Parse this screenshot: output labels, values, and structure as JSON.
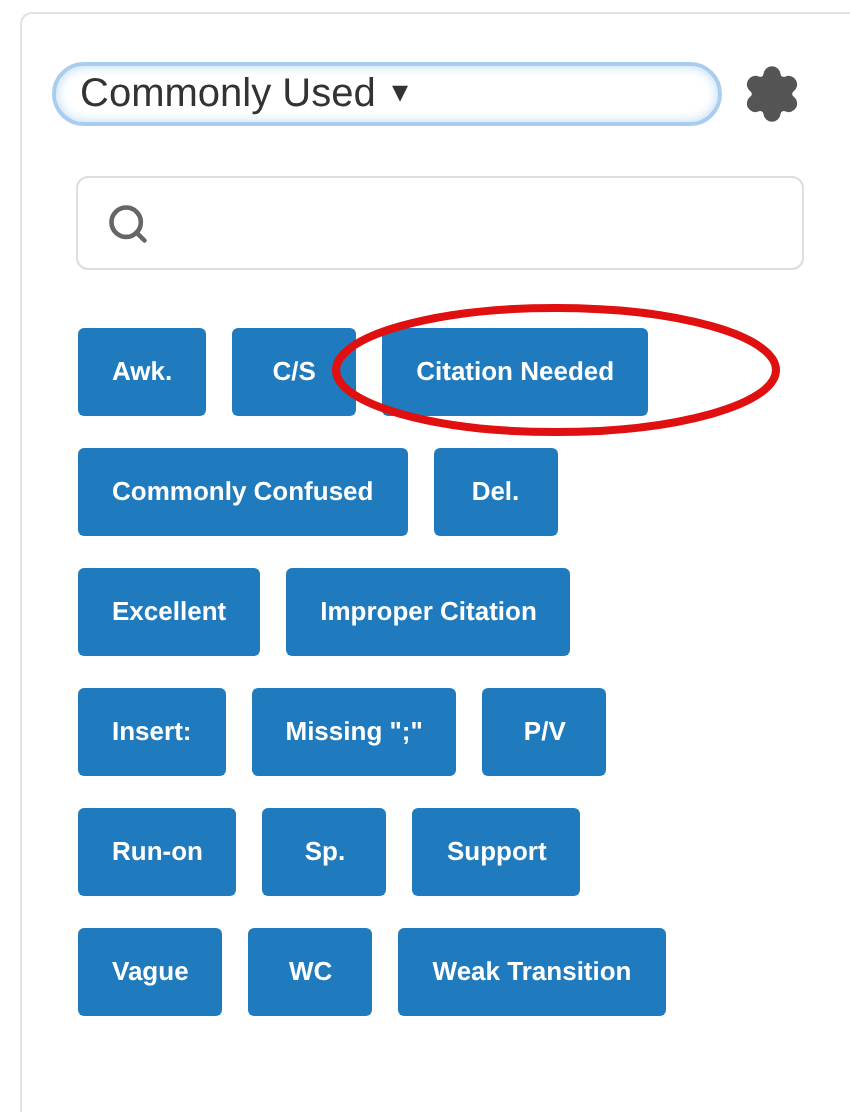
{
  "category_select": {
    "value": "Commonly Used",
    "caret": "▾"
  },
  "comment_rows": [
    [
      {
        "label": "Awk.",
        "circled": false
      },
      {
        "label": "C/S",
        "circled": false
      },
      {
        "label": "Citation Needed",
        "circled": true
      }
    ],
    [
      {
        "label": "Commonly Confused",
        "circled": false
      },
      {
        "label": "Del.",
        "circled": false
      }
    ],
    [
      {
        "label": "Excellent",
        "circled": false
      },
      {
        "label": "Improper Citation",
        "circled": false
      }
    ],
    [
      {
        "label": "Insert:",
        "circled": false
      },
      {
        "label": "Missing \";\"",
        "circled": false
      },
      {
        "label": "P/V",
        "circled": false
      }
    ],
    [
      {
        "label": "Run-on",
        "circled": false
      },
      {
        "label": "Sp.",
        "circled": false
      },
      {
        "label": "Support",
        "circled": false
      }
    ],
    [
      {
        "label": "Vague",
        "circled": false
      },
      {
        "label": "WC",
        "circled": false
      },
      {
        "label": "Weak Transition",
        "circled": false
      }
    ]
  ]
}
